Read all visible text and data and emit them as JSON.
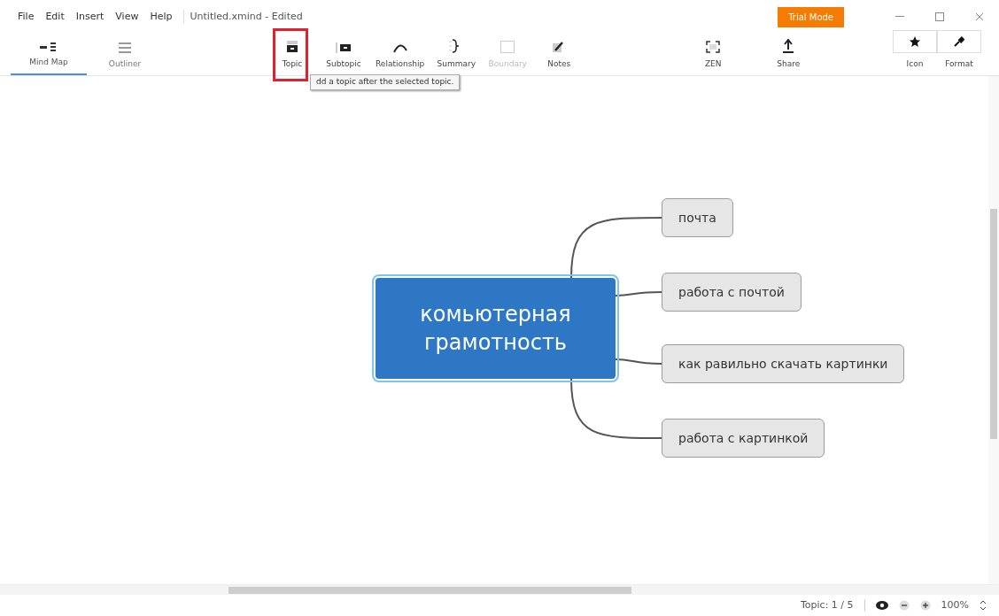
{
  "menu": [
    "File",
    "Edit",
    "Insert",
    "View",
    "Help"
  ],
  "document_title": "Untitled.xmind - Edited",
  "trial_badge": "Trial Mode",
  "view_tabs": [
    {
      "label": "Mind Map",
      "selected": true
    },
    {
      "label": "Outliner",
      "selected": false
    }
  ],
  "tools": [
    {
      "label": "Topic",
      "disabled": false
    },
    {
      "label": "Subtopic",
      "disabled": false
    },
    {
      "label": "Relationship",
      "disabled": false
    },
    {
      "label": "Summary",
      "disabled": false
    },
    {
      "label": "Boundary",
      "disabled": true
    },
    {
      "label": "Notes",
      "disabled": false
    },
    {
      "label": "ZEN",
      "disabled": false
    },
    {
      "label": "Share",
      "disabled": false
    }
  ],
  "panel_buttons": [
    "Icon",
    "Format"
  ],
  "tooltip": "dd a topic after the selected topic.",
  "mind_map": {
    "central": {
      "text": "комьютерная грамотность",
      "selected": true
    },
    "children": [
      {
        "text": "почта"
      },
      {
        "text": "работа с почтой"
      },
      {
        "text": "как равильно скачать картинки"
      },
      {
        "text": "работа с картинкой"
      }
    ]
  },
  "status_bar": {
    "topic_count": "Topic: 1 / 5",
    "zoom": "100%"
  }
}
